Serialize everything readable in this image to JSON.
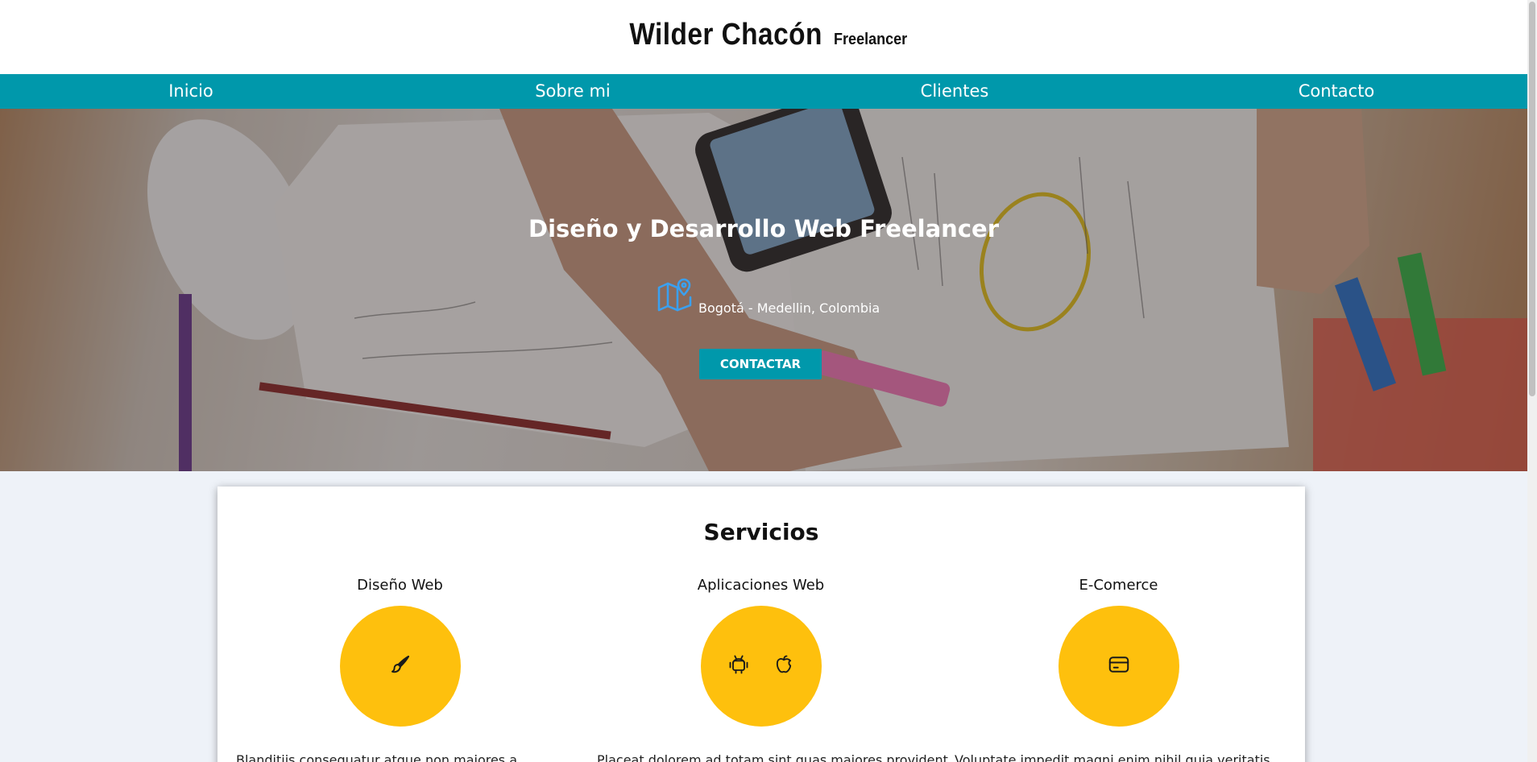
{
  "header": {
    "name": "Wilder Chacón",
    "tagline": "Freelancer"
  },
  "nav": {
    "items": [
      {
        "label": "Inicio"
      },
      {
        "label": "Sobre mi"
      },
      {
        "label": "Clientes"
      },
      {
        "label": "Contacto"
      }
    ]
  },
  "hero": {
    "title": "Diseño y Desarrollo Web Freelancer",
    "location": "Bogotá - Medellin, Colombia",
    "location_icon": "map-pin-icon",
    "button_label": "CONTACTAR"
  },
  "services": {
    "title": "Servicios",
    "items": [
      {
        "name": "Diseño Web",
        "icons": [
          "brush-icon"
        ],
        "text": "Blanditiis consequatur atque non maiores a"
      },
      {
        "name": "Aplicaciones Web",
        "icons": [
          "android-icon",
          "apple-icon"
        ],
        "text": "Placeat dolorem ad totam sint quas maiores provident"
      },
      {
        "name": "E-Comerce",
        "icons": [
          "credit-card-icon"
        ],
        "text": "Voluptate impedit magni enim nihil quia veritatis"
      }
    ]
  },
  "colors": {
    "accent": "#0098ab",
    "service_circle": "#fec00d",
    "location_icon": "#3aa0f0"
  }
}
